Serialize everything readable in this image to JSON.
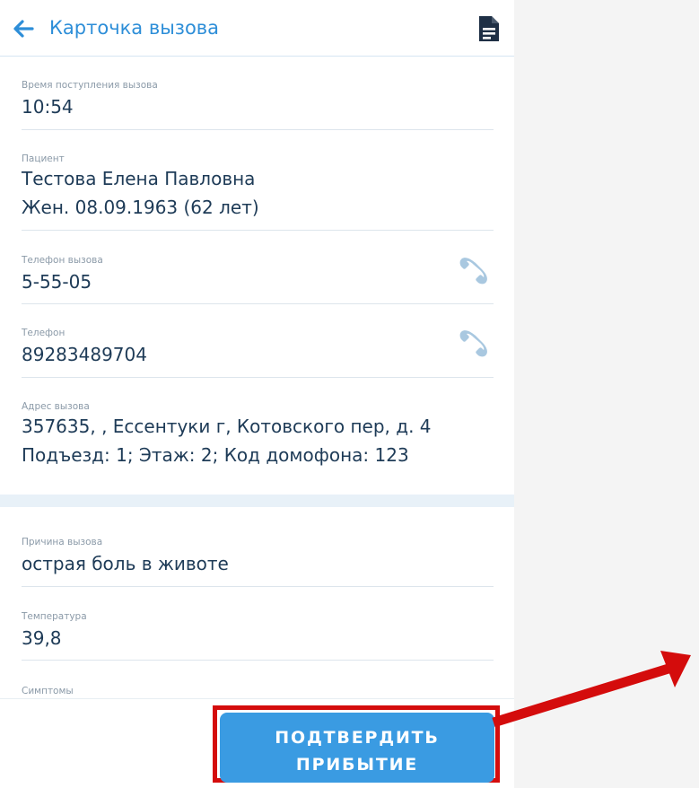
{
  "header": {
    "title": "Карточка вызова"
  },
  "fields": {
    "call_time": {
      "label": "Время поступления вызова",
      "value": "10:54"
    },
    "patient": {
      "label": "Пациент",
      "name": "Тестова Елена Павловна",
      "details": "Жен. 08.09.1963 (62 лет)"
    },
    "call_phone": {
      "label": "Телефон вызова",
      "value": "5-55-05"
    },
    "phone": {
      "label": "Телефон",
      "value": "89283489704"
    },
    "address": {
      "label": "Адрес вызова",
      "line1": "357635, , Ессентуки г, Котовского пер, д. 4",
      "line2": "Подъезд: 1; Этаж: 2; Код домофона: 123"
    },
    "reason": {
      "label": "Причина вызова",
      "value": "острая боль в животе"
    },
    "temperature": {
      "label": "Температура",
      "value": "39,8"
    },
    "symptoms": {
      "label": "Симптомы"
    }
  },
  "actions": {
    "confirm_line1": "ПОДТВЕРДИТЬ",
    "confirm_line2": "ПРИБЫТИЕ"
  },
  "colors": {
    "accent": "#2d8ed8",
    "button": "#3a9be2",
    "highlight": "#d40c0c",
    "text": "#1e3b57",
    "label": "#8b9aa8"
  },
  "icons": {
    "back": "arrow-left-icon",
    "document": "document-icon",
    "phone": "phone-icon"
  }
}
